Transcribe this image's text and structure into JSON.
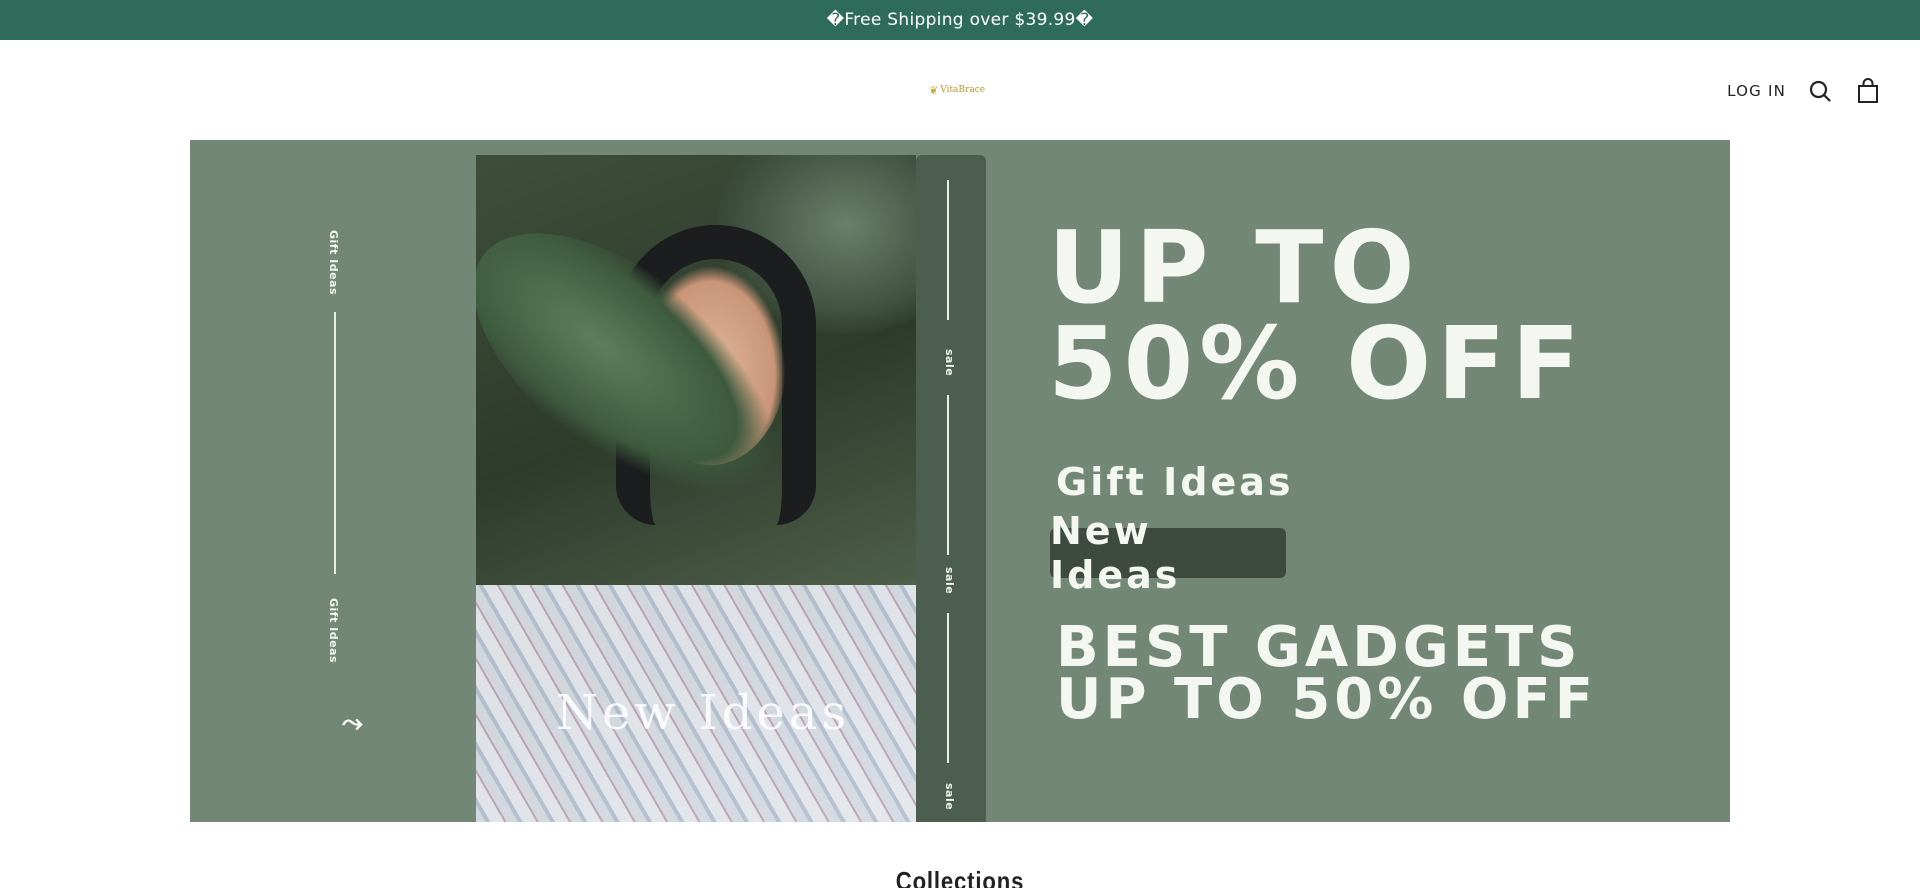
{
  "announcement": {
    "text": "�Free Shipping over $39.99�"
  },
  "header": {
    "logo_text": "VitaBrace",
    "login_label": "LOG IN",
    "icons": {
      "search": "search-icon",
      "cart": "shopping-bag-icon"
    }
  },
  "hero": {
    "side_label_top": "Gift Ideas",
    "side_label_bottom": "Gift Ideas",
    "strip_labels": [
      "sale",
      "sale",
      "sale"
    ],
    "photo_caption": "New Ideas",
    "headline_line1": "UP TO",
    "headline_line2": "50% OFF",
    "gift_ideas": "Gift Ideas",
    "new_ideas_button": "New Ideas",
    "gadgets_line1": "BEST GADGETS",
    "gadgets_line2": "UP TO 50% OFF"
  },
  "section": {
    "collections_title": "Collections"
  },
  "colors": {
    "announcement_bg": "#2f6b5b",
    "hero_bg": "#738776",
    "strip_bg": "#4b5e4f",
    "logo": "#b9952f"
  }
}
